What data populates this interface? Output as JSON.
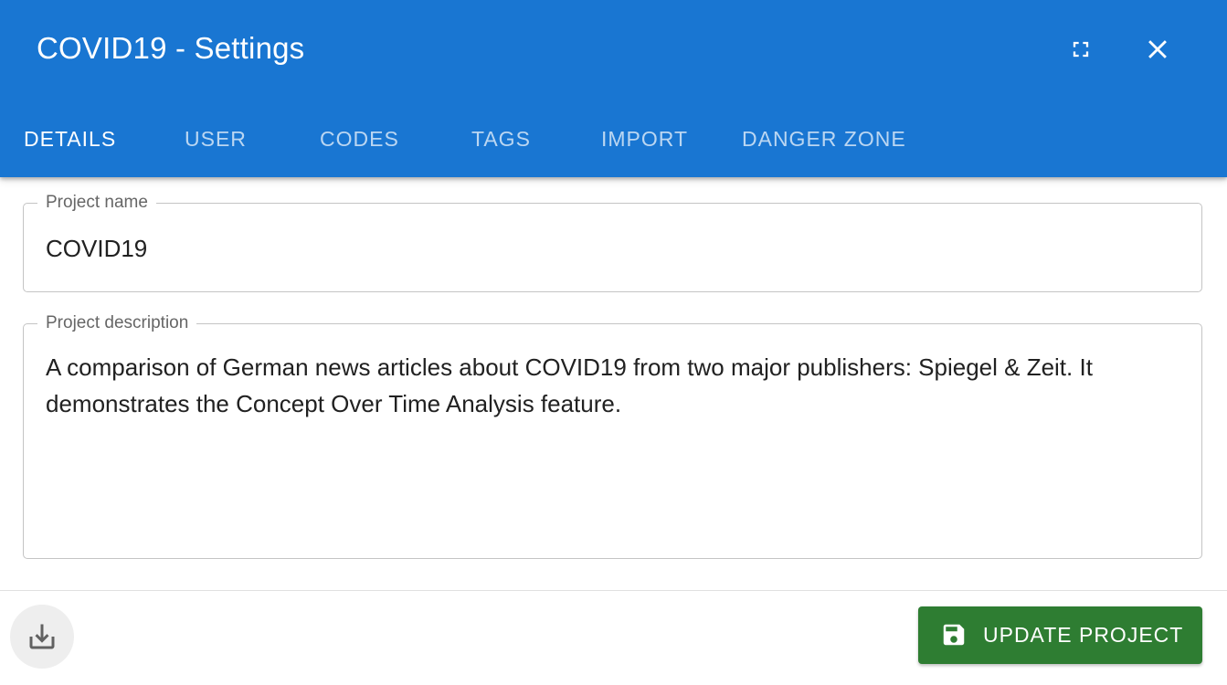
{
  "dialog": {
    "title": "COVID19 - Settings",
    "fullscreen_icon": "fullscreen-icon",
    "close_icon": "close-icon",
    "header_color": "#1976d2"
  },
  "tabs": [
    {
      "label": "DETAILS",
      "active": true
    },
    {
      "label": "USER",
      "active": false
    },
    {
      "label": "CODES",
      "active": false
    },
    {
      "label": "TAGS",
      "active": false
    },
    {
      "label": "IMPORT",
      "active": false
    },
    {
      "label": "DANGER ZONE",
      "active": false
    }
  ],
  "form": {
    "project_name": {
      "label": "Project name",
      "value": "COVID19"
    },
    "project_description": {
      "label": "Project description",
      "value": "A comparison of German news articles about COVID19 from two major publishers: Spiegel & Zeit. It demonstrates the Concept Over Time Analysis feature."
    }
  },
  "footer": {
    "download_icon": "download-icon",
    "update_button": {
      "label": "UPDATE PROJECT",
      "icon": "save-icon",
      "color": "#2e7d32"
    }
  }
}
